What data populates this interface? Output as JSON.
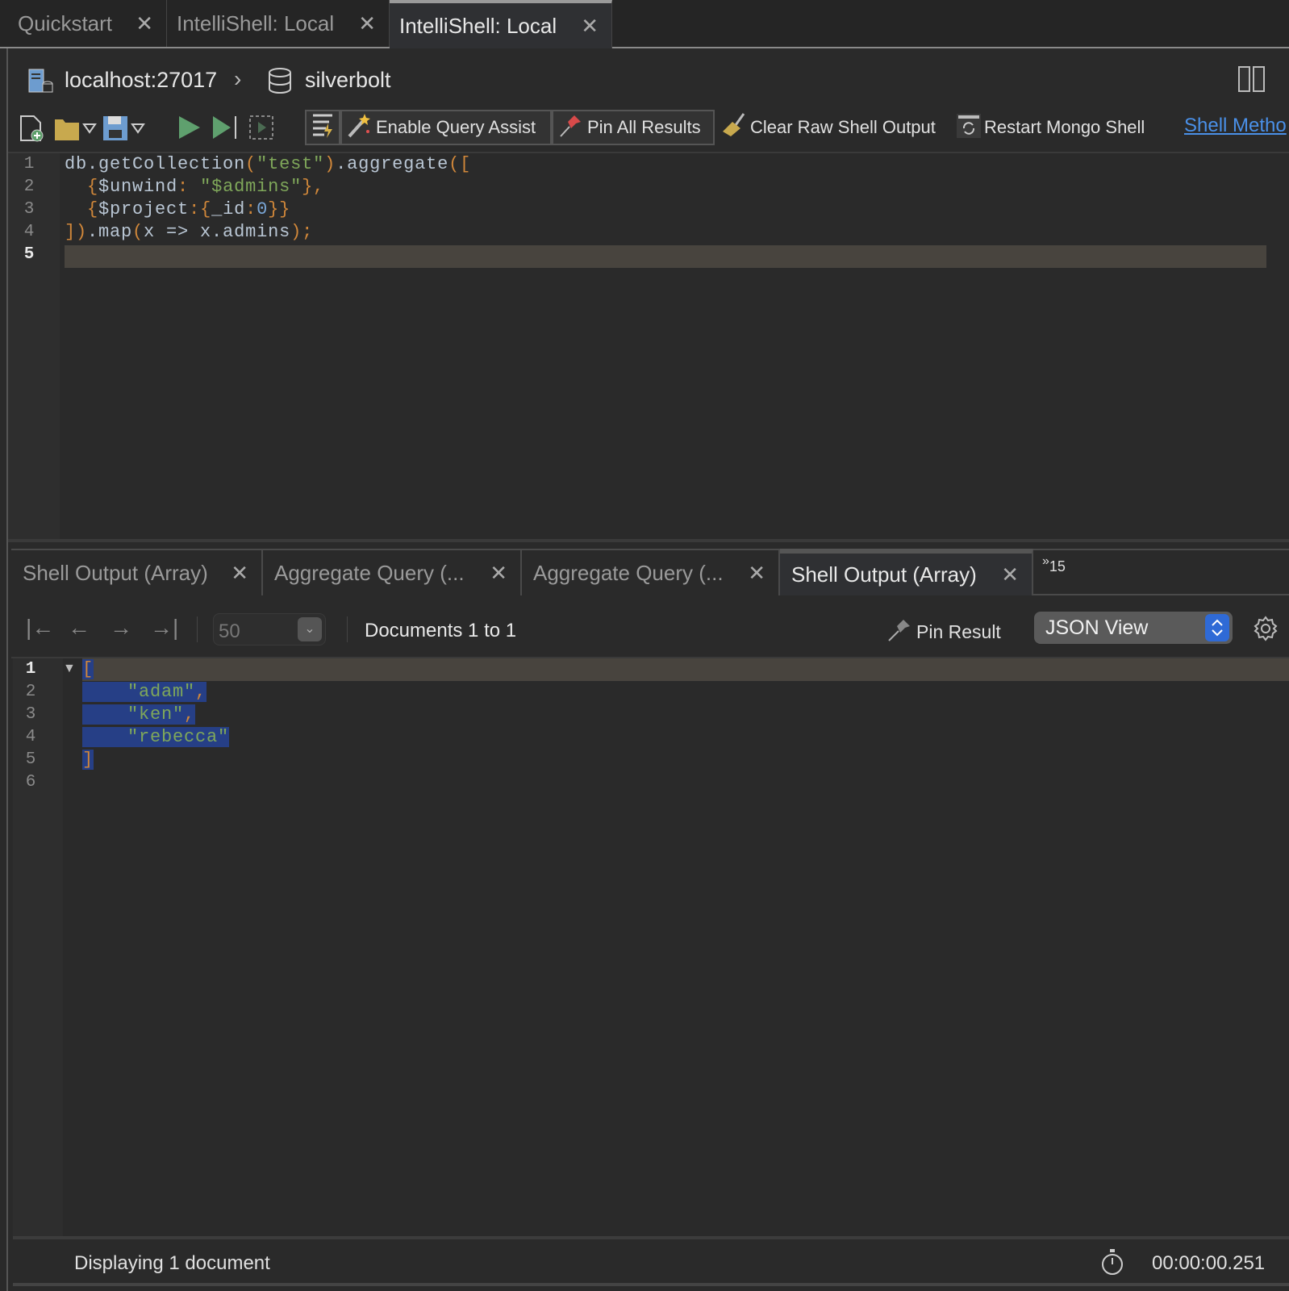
{
  "window_tabs": [
    {
      "label": "Quickstart",
      "active": false
    },
    {
      "label": "IntelliShell: Local",
      "active": false
    },
    {
      "label": "IntelliShell: Local",
      "active": true
    }
  ],
  "breadcrumb": {
    "server": "localhost:27017",
    "database": "silverbolt"
  },
  "toolbar": {
    "enable_query_assist": "Enable Query Assist",
    "pin_all_results": "Pin All Results",
    "clear_raw_shell_output": "Clear Raw Shell Output",
    "restart_mongo_shell": "Restart Mongo Shell",
    "shell_methods_link": "Shell Metho"
  },
  "editor": {
    "line_numbers": [
      "1",
      "2",
      "3",
      "4",
      "5"
    ],
    "current_line": 5,
    "lines": [
      [
        {
          "t": "db.getCollection",
          "c": "plain"
        },
        {
          "t": "(",
          "c": "punc"
        },
        {
          "t": "\"test\"",
          "c": "str"
        },
        {
          "t": ")",
          "c": "punc"
        },
        {
          "t": ".aggregate",
          "c": "plain"
        },
        {
          "t": "([",
          "c": "punc"
        }
      ],
      [
        {
          "t": "  ",
          "c": "plain"
        },
        {
          "t": "{",
          "c": "punc"
        },
        {
          "t": "$unwind",
          "c": "plain"
        },
        {
          "t": ": ",
          "c": "punc"
        },
        {
          "t": "\"$admins\"",
          "c": "str"
        },
        {
          "t": "},",
          "c": "punc"
        }
      ],
      [
        {
          "t": "  ",
          "c": "plain"
        },
        {
          "t": "{",
          "c": "punc"
        },
        {
          "t": "$project",
          "c": "plain"
        },
        {
          "t": ":{",
          "c": "punc"
        },
        {
          "t": "_id",
          "c": "plain"
        },
        {
          "t": ":",
          "c": "punc"
        },
        {
          "t": "0",
          "c": "num"
        },
        {
          "t": "}}",
          "c": "punc"
        }
      ],
      [
        {
          "t": "])",
          "c": "punc"
        },
        {
          "t": ".map",
          "c": "plain"
        },
        {
          "t": "(",
          "c": "punc"
        },
        {
          "t": "x => x.admins",
          "c": "plain"
        },
        {
          "t": ");",
          "c": "punc"
        }
      ],
      []
    ]
  },
  "result_tabs": [
    {
      "label": "Shell Output (Array)",
      "active": false
    },
    {
      "label": "Aggregate Query (...",
      "active": false
    },
    {
      "label": "Aggregate Query (...",
      "active": false
    },
    {
      "label": "Shell Output (Array)",
      "active": true
    }
  ],
  "overflow_tabs": {
    "chevron": "»",
    "count": "15"
  },
  "pager": {
    "page_size": "50",
    "range": "Documents 1 to 1"
  },
  "pin_result": "Pin Result",
  "view_mode": "JSON View",
  "result": {
    "line_numbers": [
      "1",
      "2",
      "3",
      "4",
      "5",
      "6"
    ],
    "lines": [
      [
        {
          "t": "[",
          "c": "punc"
        }
      ],
      [
        {
          "t": "    ",
          "c": "plain"
        },
        {
          "t": "\"adam\"",
          "c": "str"
        },
        {
          "t": ",",
          "c": "punc"
        }
      ],
      [
        {
          "t": "    ",
          "c": "plain"
        },
        {
          "t": "\"ken\"",
          "c": "str"
        },
        {
          "t": ",",
          "c": "punc"
        }
      ],
      [
        {
          "t": "    ",
          "c": "plain"
        },
        {
          "t": "\"rebecca\"",
          "c": "str"
        }
      ],
      [
        {
          "t": "]",
          "c": "punc"
        }
      ],
      []
    ]
  },
  "status": {
    "message": "Displaying 1 document",
    "elapsed": "00:00:00.251"
  },
  "colors": {
    "plain": "#b9c6d4",
    "punc": "#d0873a",
    "str": "#7fa75a",
    "num": "#7aa6d6",
    "selection": "#263f86",
    "current_line": "#48443e",
    "link": "#4a90e8"
  }
}
